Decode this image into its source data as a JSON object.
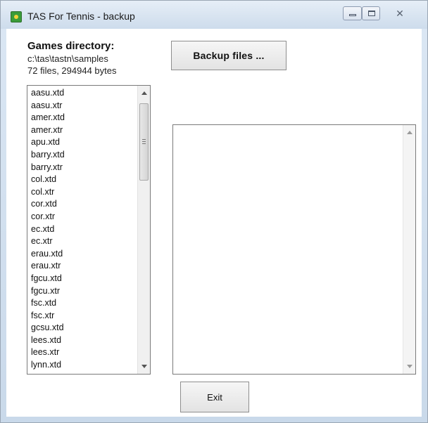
{
  "window": {
    "title": "TAS For Tennis - backup",
    "close_glyph": "✕"
  },
  "games_directory": {
    "label": "Games directory:",
    "path": "c:\\tas\\tastn\\samples",
    "info": "72 files, 294944 bytes"
  },
  "file_list": {
    "items": [
      "aasu.xtd",
      "aasu.xtr",
      "amer.xtd",
      "amer.xtr",
      "apu.xtd",
      "barry.xtd",
      "barry.xtr",
      "col.xtd",
      "col.xtr",
      "cor.xtd",
      "cor.xtr",
      "ec.xtd",
      "ec.xtr",
      "erau.xtd",
      "erau.xtr",
      "fgcu.xtd",
      "fgcu.xtr",
      "fsc.xtd",
      "fsc.xtr",
      "gcsu.xtd",
      "lees.xtd",
      "lees.xtr",
      "lynn.xtd"
    ]
  },
  "buttons": {
    "backup_label": "Backup files ...",
    "exit_label": "Exit"
  },
  "log": {
    "value": ""
  }
}
